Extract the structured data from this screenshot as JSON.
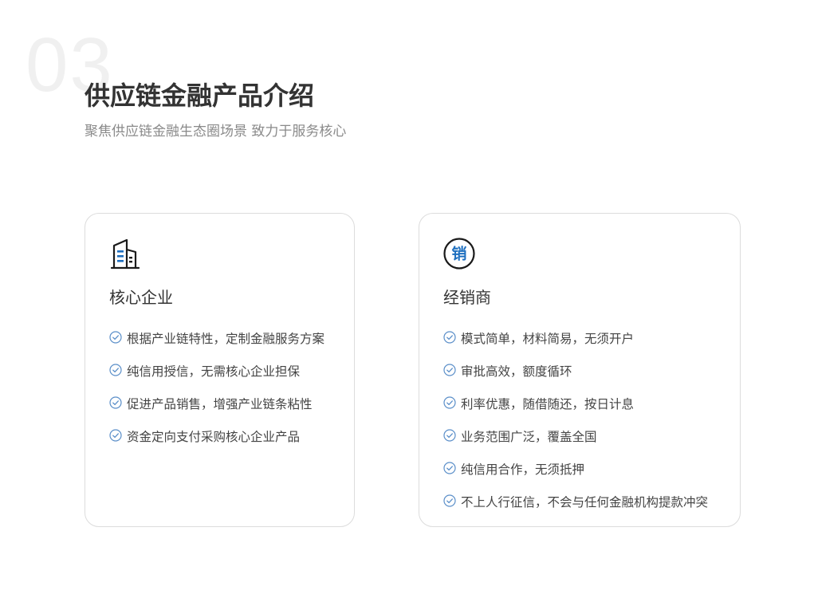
{
  "header": {
    "section_number": "03",
    "title": "供应链金融产品介绍",
    "subtitle": "聚焦供应链金融生态圈场景 致力于服务核心"
  },
  "colors": {
    "accent": "#1e6fbf",
    "check": "#5b8fc9",
    "title": "#333333",
    "subtitle": "#8a8a8a",
    "card_border": "#dcdcdc"
  },
  "cards": [
    {
      "icon": "building-icon",
      "title": "核心企业",
      "items": [
        "根据产业链特性，定制金融服务方案",
        "纯信用授信，无需核心企业担保",
        "促进产品销售，增强产业链条粘性",
        "资金定向支付采购核心企业产品"
      ]
    },
    {
      "icon": "sales-badge-icon",
      "badge_char": "销",
      "title": "经销商",
      "items": [
        "模式简单，材料简易，无须开户",
        "审批高效，额度循环",
        "利率优惠，随借随还，按日计息",
        "业务范围广泛，覆盖全国",
        "纯信用合作，无须抵押",
        "不上人行征信，不会与任何金融机构提款冲突"
      ]
    }
  ]
}
